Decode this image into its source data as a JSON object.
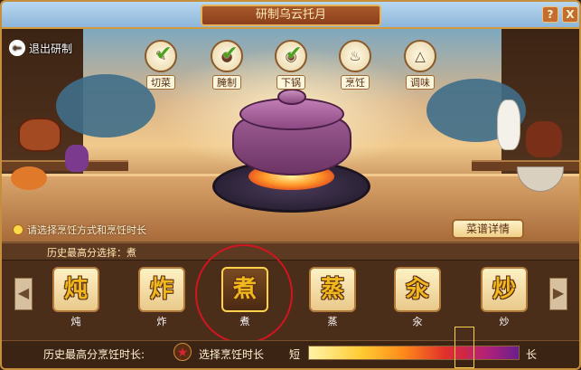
{
  "window": {
    "title": "研制乌云托月",
    "help_label": "?",
    "close_label": "X"
  },
  "back": {
    "icon": "arrow-left",
    "label": "退出研制"
  },
  "steps": [
    {
      "label": "切菜",
      "done": true
    },
    {
      "label": "腌制",
      "done": true
    },
    {
      "label": "下锅",
      "done": true
    },
    {
      "label": "烹饪",
      "done": false
    },
    {
      "label": "调味",
      "done": false
    }
  ],
  "hint": "请选择烹饪方式和烹饪时长",
  "recipe_button": "菜谱详情",
  "history_method": "历史最高分选择：煮",
  "methods": [
    {
      "glyph": "炖",
      "name": "炖",
      "selected": false
    },
    {
      "glyph": "炸",
      "name": "炸",
      "selected": false
    },
    {
      "glyph": "煮",
      "name": "煮",
      "selected": true
    },
    {
      "glyph": "蒸",
      "name": "蒸",
      "selected": false
    },
    {
      "glyph": "汆",
      "name": "汆",
      "selected": false
    },
    {
      "glyph": "炒",
      "name": "炒",
      "selected": false
    }
  ],
  "bottom": {
    "history_time_label": "历史最高分烹饪时长:",
    "select_time_label": "选择烹饪时长",
    "short_label": "短",
    "long_label": "长",
    "star_glyph": "★",
    "time_position": 0.75
  },
  "colors": {
    "accent": "#d39a3c",
    "selection_ring": "#d4141e",
    "check": "#4ca21e"
  }
}
